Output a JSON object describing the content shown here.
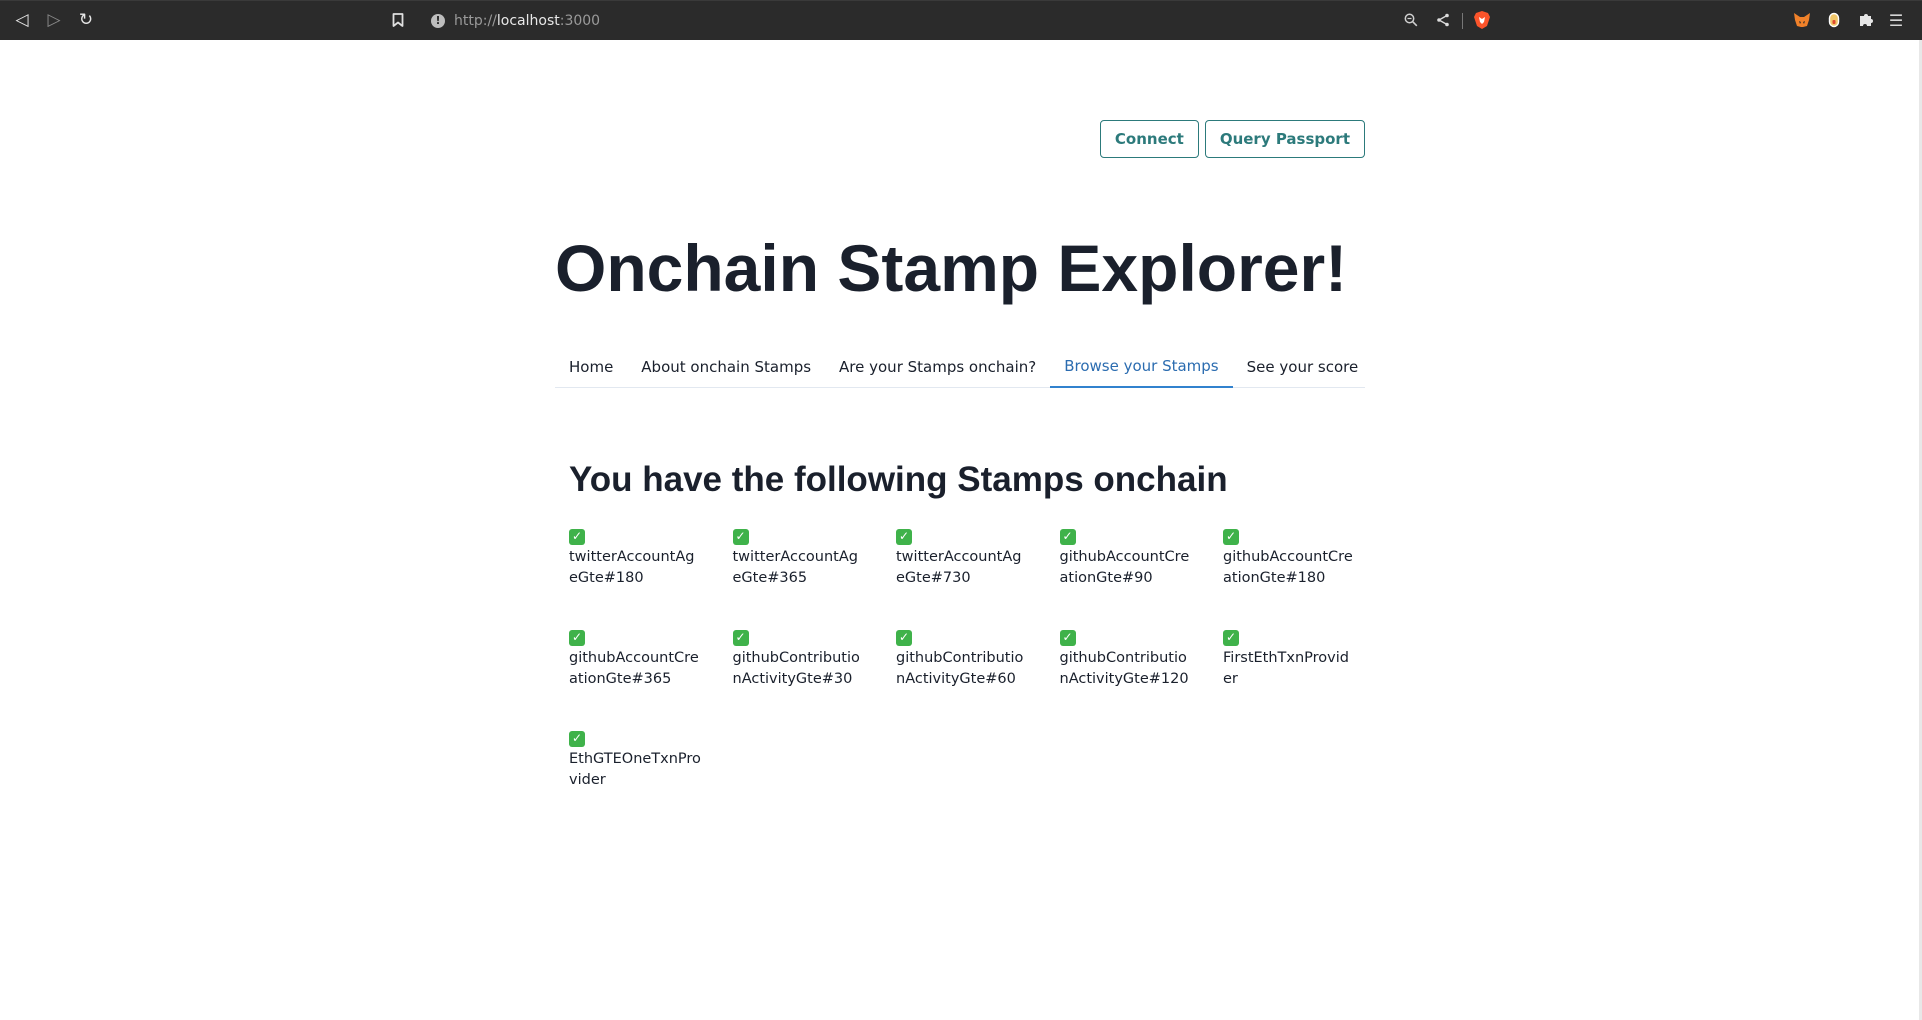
{
  "browser": {
    "url_scheme": "http://",
    "url_host": "localhost",
    "url_port": ":3000",
    "back_glyph": "◁",
    "forward_glyph": "▷",
    "reload_glyph": "↻",
    "bookmark_glyph": "🔖",
    "zoom_glyph": "⚲",
    "share_glyph": "⋖",
    "extensions_glyph": "✱",
    "menu_glyph": "☰",
    "info_glyph": "!"
  },
  "header": {
    "connect_label": "Connect",
    "query_label": "Query Passport"
  },
  "page": {
    "title": "Onchain Stamp Explorer!"
  },
  "tabs": [
    {
      "label": "Home"
    },
    {
      "label": "About onchain Stamps"
    },
    {
      "label": "Are your Stamps onchain?"
    },
    {
      "label": "Browse your Stamps"
    },
    {
      "label": "See your score"
    }
  ],
  "active_tab": "Browse your Stamps",
  "main": {
    "section_title": "You have the following Stamps onchain",
    "check_glyph": "✓",
    "stamps": [
      {
        "name": "twitterAccountAgeGte#180"
      },
      {
        "name": "twitterAccountAgeGte#365"
      },
      {
        "name": "twitterAccountAgeGte#730"
      },
      {
        "name": "githubAccountCreationGte#90"
      },
      {
        "name": "githubAccountCreationGte#180"
      },
      {
        "name": "githubAccountCreationGte#365"
      },
      {
        "name": "githubContributionActivityGte#30"
      },
      {
        "name": "githubContributionActivityGte#60"
      },
      {
        "name": "githubContributionActivityGte#120"
      },
      {
        "name": "FirstEthTxnProvider"
      },
      {
        "name": "EthGTEOneTxnProvider"
      }
    ]
  },
  "colors": {
    "accent_teal": "#2c7a7b",
    "tab_active": "#3182ce",
    "check_green": "#3fb24a",
    "text_dark": "#1a202c"
  }
}
